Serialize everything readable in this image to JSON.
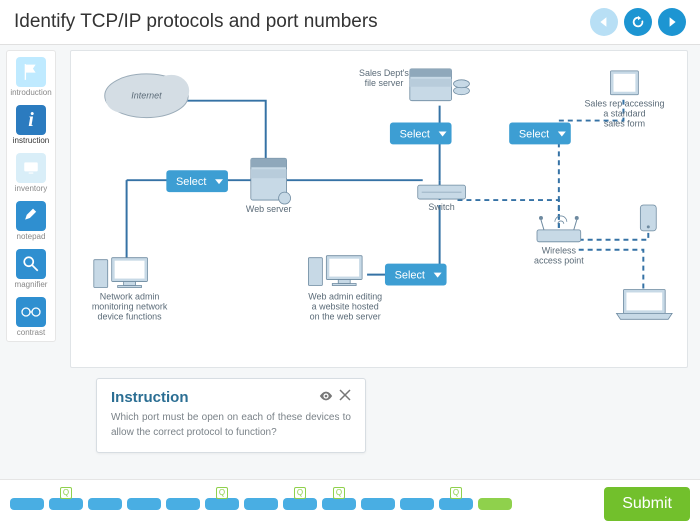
{
  "header": {
    "title": "Identify TCP/IP protocols and port numbers"
  },
  "sidebar": {
    "items": [
      {
        "label": "introduction"
      },
      {
        "label": "instruction"
      },
      {
        "label": "inventory"
      },
      {
        "label": "notepad"
      },
      {
        "label": "magnifier"
      },
      {
        "label": "contrast"
      }
    ]
  },
  "diagram": {
    "nodes": {
      "internet": "Internet",
      "file_server": "Sales Dept's\nfile server",
      "web_server": "Web server",
      "switch": "Switch",
      "wireless_ap": "Wireless\naccess point",
      "net_admin": "Network admin\nmonitoring network\ndevice functions",
      "web_admin": "Web admin editing\na website hosted\non the web server",
      "sales_rep": "Sales rep accessing\na standard\nsales form"
    },
    "select_label": "Select"
  },
  "instruction": {
    "title": "Instruction",
    "text": "Which port must be open on each of these devices to allow the correct protocol to function?"
  },
  "footer": {
    "submit": "Submit"
  }
}
